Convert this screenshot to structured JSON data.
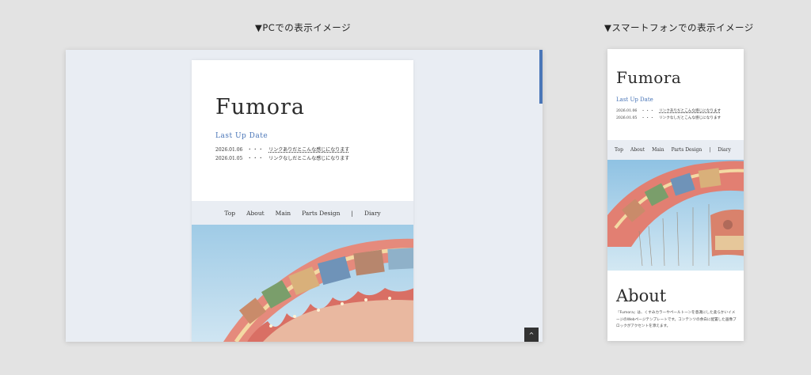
{
  "captions": {
    "pc": "▼PCでの表示イメージ",
    "smartphone": "▼スマートフォンでの表示イメージ"
  },
  "site": {
    "logo": "Fumora",
    "update_title": "Last Up Date",
    "news": [
      {
        "date": "2026.01.06",
        "dots": "・・・",
        "text": "リンクありだとこんな感じになります",
        "linked": true
      },
      {
        "date": "2026.01.05",
        "dots": "・・・",
        "text": "リンクなしだとこんな感じになります",
        "linked": false
      }
    ],
    "nav": [
      "Top",
      "About",
      "Main",
      "Parts Design",
      "|",
      "Diary"
    ],
    "about_title": "About",
    "about_text": "『Fumora』は、くすみカラーやペールトーンを意識にした柔らかいイメージのWebページテンプレートです。コンテンツの余白に配置した画像ブロックがアクセントを添えます。"
  },
  "colors": {
    "accent": "#4a76b8",
    "nav_bg": "#e9edf3",
    "frame_bg": "#e9edf3",
    "page_bg": "#e3e3e3"
  },
  "icons": {
    "pagetop": "chevron-up-icon"
  },
  "pagetop_label": "^"
}
